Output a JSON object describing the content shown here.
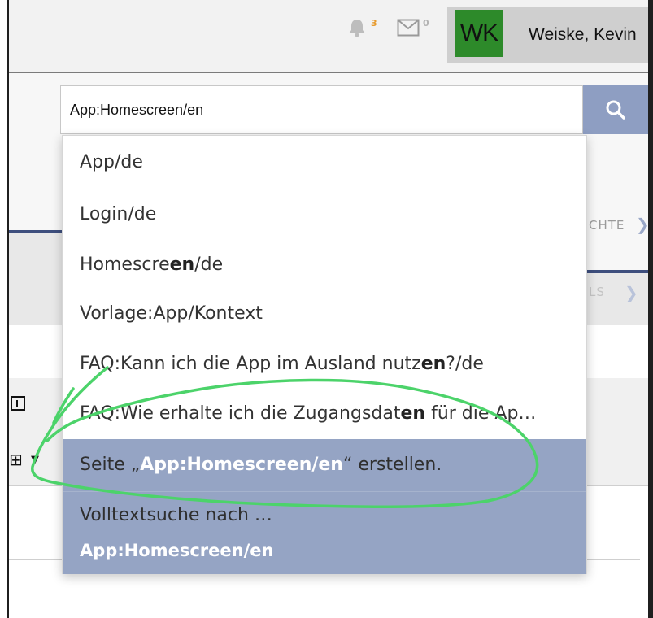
{
  "header": {
    "notifications_count": "3",
    "messages_count": "0",
    "user_initials": "WK",
    "user_name": "Weiske, Kevin"
  },
  "search": {
    "value": "App:Homescreen/en",
    "button_icon": "search-icon"
  },
  "background_page": {
    "nav_item_1": "CHTE",
    "nav_item_2": "LS"
  },
  "suggestions": [
    {
      "pre": "App/de",
      "hl": "",
      "post": ""
    },
    {
      "pre": "Login/de",
      "hl": "",
      "post": ""
    },
    {
      "pre": "Homescre",
      "hl": "en",
      "post": "/de"
    },
    {
      "pre": "Vorlage:App/Kontext",
      "hl": "",
      "post": ""
    },
    {
      "pre": "FAQ:Kann ich die App im Ausland nutz",
      "hl": "en",
      "post": "?/de"
    },
    {
      "pre": "FAQ:Wie erhalte ich die Zugangsdat",
      "hl": "en",
      "post": " für die Ap…"
    }
  ],
  "create_page": {
    "prefix": "Seite „",
    "term": "App:Homescreen/en",
    "suffix": "“ erstellen."
  },
  "fulltext": {
    "label": "Volltextsuche nach …",
    "term": "App:Homescreen/en"
  },
  "colors": {
    "accent": "#8e9ec2",
    "highlight_row": "#95a4c4",
    "avatar_bg": "#2d8a2a",
    "annotation": "#4cd36a"
  }
}
